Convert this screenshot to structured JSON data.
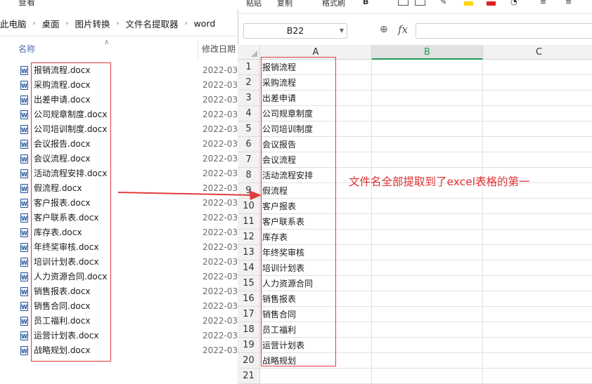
{
  "explorer": {
    "top_tab_label": "查看",
    "breadcrumb": [
      "此电脑",
      "桌面",
      "图片转换",
      "文件名提取器",
      "word"
    ],
    "columns": {
      "name": "名称",
      "date": "修改日期"
    },
    "files": [
      {
        "name": "报销流程.docx",
        "date": "2022-03-"
      },
      {
        "name": "采购流程.docx",
        "date": "2022-03-"
      },
      {
        "name": "出差申请.docx",
        "date": "2022-03-"
      },
      {
        "name": "公司规章制度.docx",
        "date": "2022-03-"
      },
      {
        "name": "公司培训制度.docx",
        "date": "2022-03-"
      },
      {
        "name": "会议报告.docx",
        "date": "2022-03-"
      },
      {
        "name": "会议流程.docx",
        "date": "2022-03-"
      },
      {
        "name": "活动流程安排.docx",
        "date": "2022-03-"
      },
      {
        "name": "假流程.docx",
        "date": "2022-03-"
      },
      {
        "name": "客户报表.docx",
        "date": "2022-03-"
      },
      {
        "name": "客户联系表.docx",
        "date": "2022-03-"
      },
      {
        "name": "库存表.docx",
        "date": "2022-03-"
      },
      {
        "name": "年终奖审核.docx",
        "date": "2022-03-"
      },
      {
        "name": "培训计划表.docx",
        "date": "2022-03-"
      },
      {
        "name": "人力资源合同.docx",
        "date": "2022-03-"
      },
      {
        "name": "销售报表.docx",
        "date": "2022-03-"
      },
      {
        "name": "销售合同.docx",
        "date": "2022-03-"
      },
      {
        "name": "员工福利.docx",
        "date": "2022-03-"
      },
      {
        "name": "运营计划表.docx",
        "date": "2022-03-"
      },
      {
        "name": "战略规划.docx",
        "date": "2022-03-"
      }
    ]
  },
  "sheet": {
    "ribbon": {
      "paste_label": "粘贴",
      "copy_label": "复制",
      "format_painter_label": "格式刷"
    },
    "name_box": "B22",
    "formula": "",
    "columns": [
      "A",
      "B",
      "C"
    ],
    "active_column": "B",
    "rows": [
      {
        "num": "1",
        "a": "报销流程"
      },
      {
        "num": "2",
        "a": "采购流程"
      },
      {
        "num": "3",
        "a": "出差申请"
      },
      {
        "num": "4",
        "a": "公司规章制度"
      },
      {
        "num": "5",
        "a": "公司培训制度"
      },
      {
        "num": "6",
        "a": "会议报告"
      },
      {
        "num": "7",
        "a": "会议流程"
      },
      {
        "num": "8",
        "a": "活动流程安排"
      },
      {
        "num": "9",
        "a": "假流程"
      },
      {
        "num": "10",
        "a": "客户报表"
      },
      {
        "num": "11",
        "a": "客户联系表"
      },
      {
        "num": "12",
        "a": "库存表"
      },
      {
        "num": "13",
        "a": "年终奖审核"
      },
      {
        "num": "14",
        "a": "培训计划表"
      },
      {
        "num": "15",
        "a": "人力资源合同"
      },
      {
        "num": "16",
        "a": "销售报表"
      },
      {
        "num": "17",
        "a": "销售合同"
      },
      {
        "num": "18",
        "a": "员工福利"
      },
      {
        "num": "19",
        "a": "运营计划表"
      },
      {
        "num": "20",
        "a": "战略规划"
      },
      {
        "num": "21",
        "a": ""
      }
    ]
  },
  "annotation": {
    "text": "文件名全部提取到了excel表格的第一",
    "color": "#e03030"
  }
}
